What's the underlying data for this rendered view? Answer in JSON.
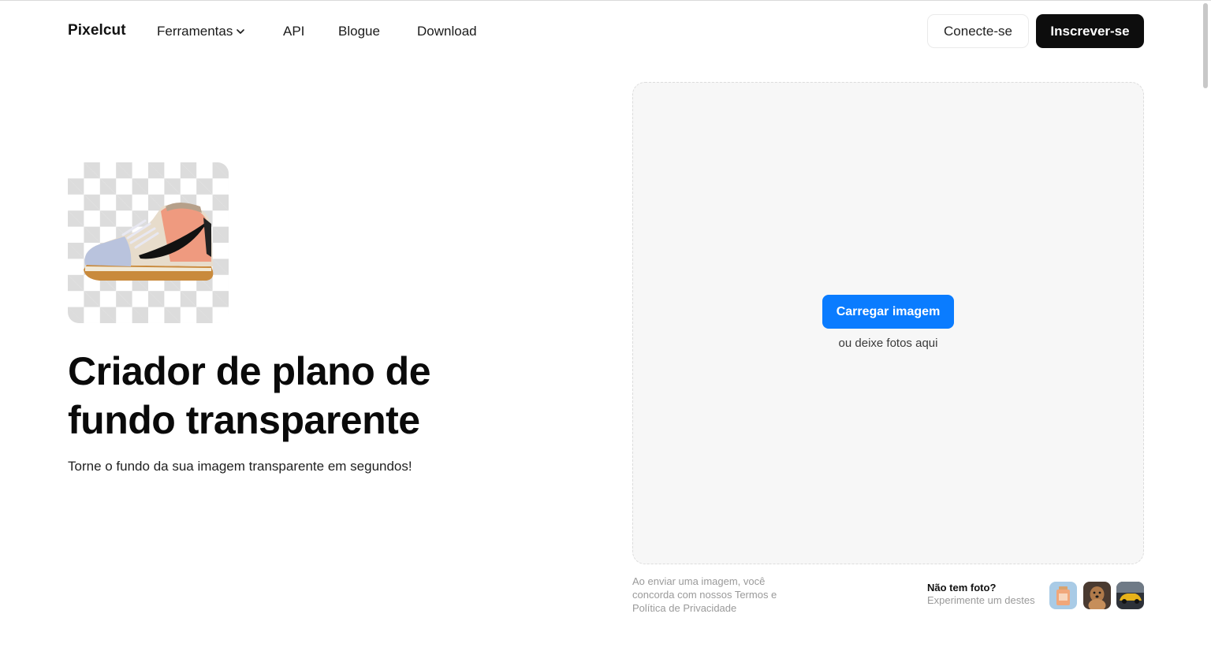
{
  "header": {
    "logo": "Pixelcut",
    "nav": {
      "tools": "Ferramentas",
      "api": "API",
      "blog": "Blogue",
      "download": "Download"
    },
    "login": "Conecte-se",
    "signup": "Inscrever-se"
  },
  "hero": {
    "title": "Criador de plano de fundo transparente",
    "subtitle": "Torne o fundo da sua imagem transparente em segundos!"
  },
  "upload": {
    "button": "Carregar imagem",
    "hint": "ou deixe fotos aqui",
    "legal": "Ao enviar uma imagem, você concorda com nossos Termos e Política de Privacidade",
    "no_photo_question": "Não tem foto?",
    "no_photo_suggestion": "Experimente um destes"
  },
  "samples": [
    "perfume-bottle-sample",
    "dog-sample",
    "car-sample"
  ],
  "colors": {
    "accent": "#0a7cff",
    "signup_bg": "#0d0d0d",
    "dropzone_bg": "#f7f7f7"
  }
}
